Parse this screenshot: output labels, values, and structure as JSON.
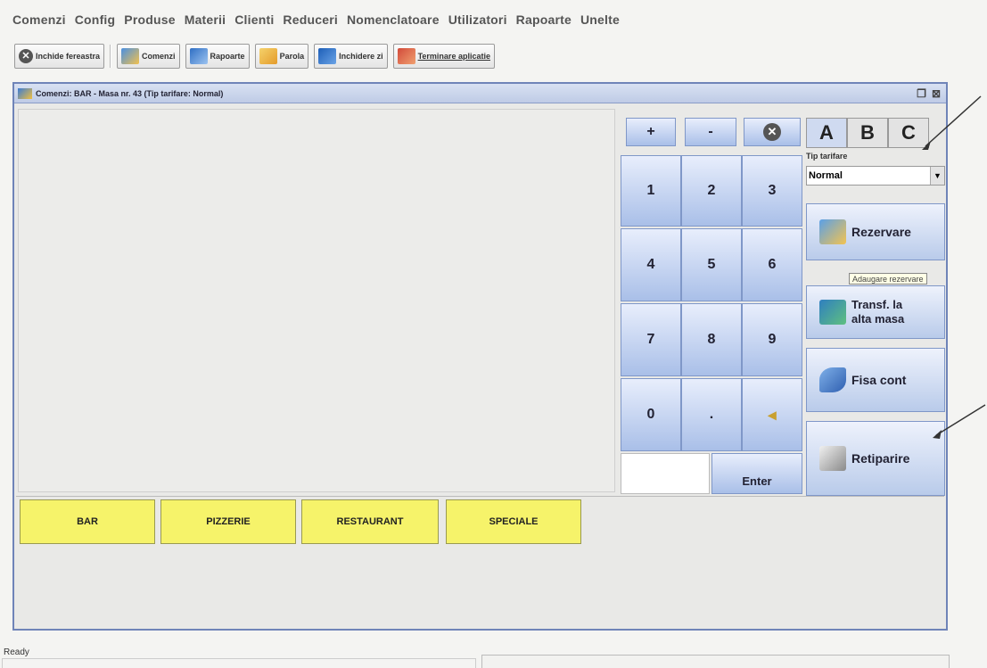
{
  "menu": {
    "items": [
      "Comenzi",
      "Config",
      "Produse",
      "Materii",
      "Clienti",
      "Reduceri",
      "Nomenclatoare",
      "Utilizatori",
      "Rapoarte",
      "Unelte"
    ]
  },
  "toolbar": {
    "close_window": "Inchide fereastra",
    "orders": "Comenzi",
    "reports": "Rapoarte",
    "password": "Parola",
    "close_day": "Inchidere zi",
    "exit_app": "Terminare aplicatie"
  },
  "window": {
    "title": "Comenzi: BAR - Masa nr. 43 (Tip tarifare: Normal)"
  },
  "keypad": {
    "plus": "+",
    "minus": "-",
    "digits": [
      "1",
      "2",
      "3",
      "4",
      "5",
      "6",
      "7",
      "8",
      "9"
    ],
    "zero": "0",
    "dot": ".",
    "enter": "Enter"
  },
  "tabs": [
    "A",
    "B",
    "C"
  ],
  "tarif": {
    "label": "Tip tarifare",
    "value": "Normal"
  },
  "side_buttons": {
    "reservation": "Rezervare",
    "add_reservation_tooltip": "Adaugare rezervare",
    "transfer_line1": "Transf. la",
    "transfer_line2": "alta masa",
    "account_sheet": "Fisa cont",
    "reprint": "Retiparire"
  },
  "categories": [
    "BAR",
    "PIZZERIE",
    "RESTAURANT",
    "SPECIALE"
  ],
  "status": {
    "text": "Ready"
  },
  "colors": {
    "category_yellow": "#f6f36a",
    "key_blue": "#a9bfe8",
    "window_border": "#6f84b8"
  }
}
